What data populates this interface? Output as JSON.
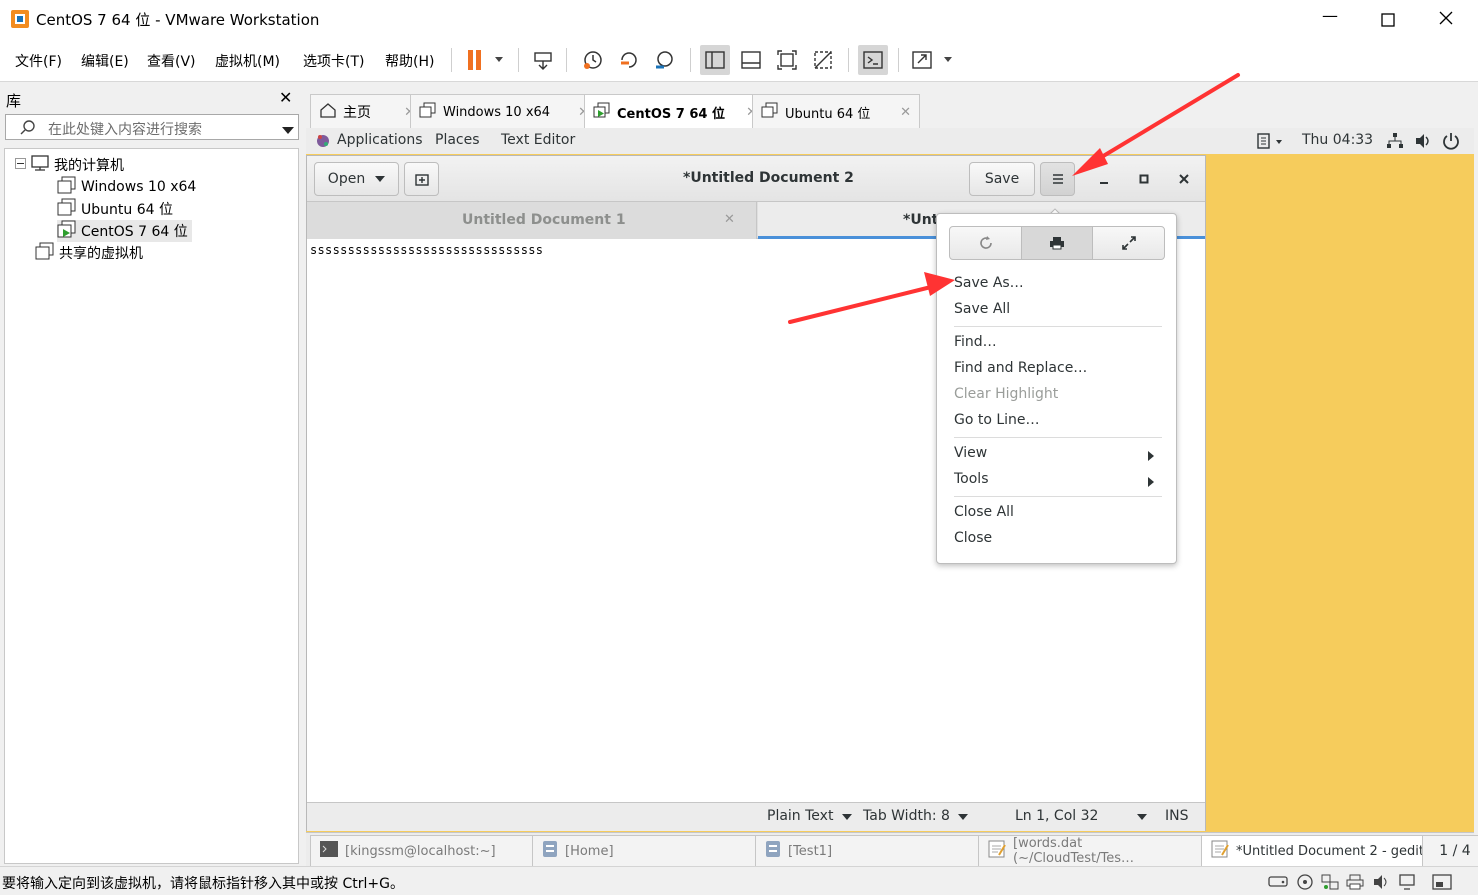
{
  "window": {
    "title": "CentOS 7 64 位 - VMware Workstation"
  },
  "menu": [
    "文件(F)",
    "编辑(E)",
    "查看(V)",
    "虚拟机(M)",
    "选项卡(T)",
    "帮助(H)"
  ],
  "library": {
    "title": "库",
    "search_placeholder": "在此处键入内容进行搜索",
    "tree": {
      "root": "我的计算机",
      "vms": [
        "Windows 10 x64",
        "Ubuntu 64 位",
        "CentOS 7 64 位"
      ],
      "shared": "共享的虚拟机"
    }
  },
  "vm_tabs": [
    {
      "label": "主页"
    },
    {
      "label": "Windows 10 x64"
    },
    {
      "label": "CentOS 7 64 位"
    },
    {
      "label": "Ubuntu 64 位"
    }
  ],
  "gnome": {
    "applications": "Applications",
    "places": "Places",
    "text_editor": "Text Editor",
    "clock": "Thu 04:33"
  },
  "gedit": {
    "open": "Open",
    "title": "*Untitled Document 2",
    "save": "Save",
    "tabs": [
      "Untitled Document 1",
      "*Unti"
    ],
    "content": "sssssssssssssssssssssssssssssss",
    "status": {
      "language": "Plain Text",
      "tab_width": "Tab Width: 8",
      "position": "Ln 1, Col 32",
      "mode": "INS"
    }
  },
  "popover": {
    "items": [
      {
        "label": "Save As…",
        "enabled": true
      },
      {
        "label": "Save All",
        "enabled": true
      },
      {
        "label": "Find…",
        "enabled": true
      },
      {
        "label": "Find and Replace…",
        "enabled": true
      },
      {
        "label": "Clear Highlight",
        "enabled": false
      },
      {
        "label": "Go to Line…",
        "enabled": true
      },
      {
        "label": "View",
        "enabled": true
      },
      {
        "label": "Tools",
        "enabled": true
      },
      {
        "label": "Close All",
        "enabled": true
      },
      {
        "label": "Close",
        "enabled": true
      }
    ]
  },
  "taskbar": {
    "items": [
      "[kingssm@localhost:~]",
      "[Home]",
      "[Test1]",
      "[words.dat (~/CloudTest/Tes…",
      "*Untitled Document 2 - gedit"
    ],
    "workspace": "1 / 4"
  },
  "statusline": "要将输入定向到该虚拟机，请将鼠标指针移入其中或按 Ctrl+G。",
  "colors": {
    "desktop": "#f6cc5c",
    "pause": "#f07020",
    "arrow": "#ff3333",
    "tab_underline": "#4a90d9"
  }
}
